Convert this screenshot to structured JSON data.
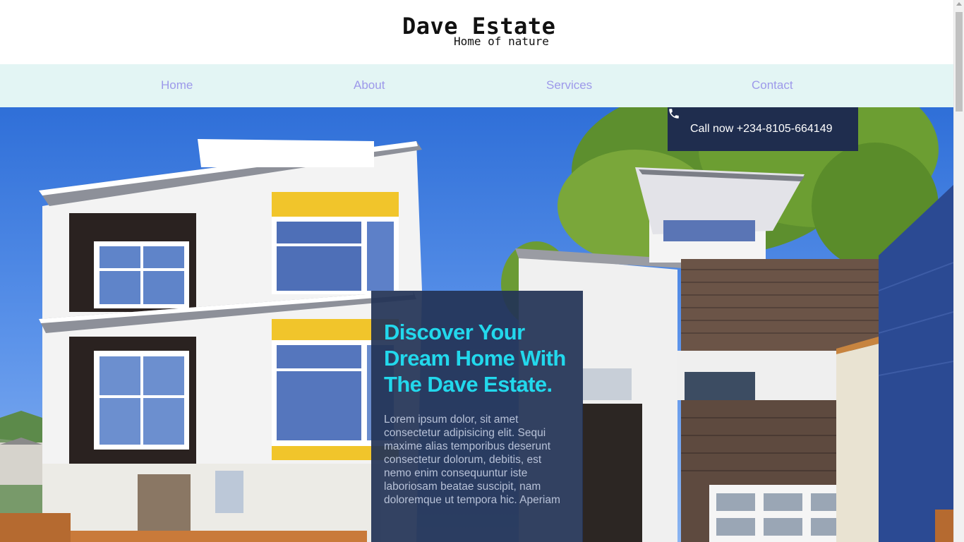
{
  "header": {
    "title": "Dave Estate",
    "tagline": "Home of nature"
  },
  "nav": {
    "items": [
      {
        "label": "Home"
      },
      {
        "label": "About"
      },
      {
        "label": "Services"
      },
      {
        "label": "Contact"
      }
    ]
  },
  "hero": {
    "call_text": "Call now +234-8105-664149",
    "call_icon": "phone-icon",
    "heading": "Discover Your Dream Home With The Dave Estate.",
    "body": "Lorem ipsum dolor, sit amet consectetur adipisicing elit. Sequi maxime alias temporibus deserunt consectetur dolorum, debitis, est nemo enim consequuntur iste laboriosam beatae suscipit, nam doloremque ut tempora hic. Aperiam"
  },
  "colors": {
    "nav_background": "#e3f5f4",
    "nav_link": "#9d99ea",
    "call_box": "#1f2d4e",
    "heading_accent": "#22d8ec",
    "card_background": "#233456"
  }
}
